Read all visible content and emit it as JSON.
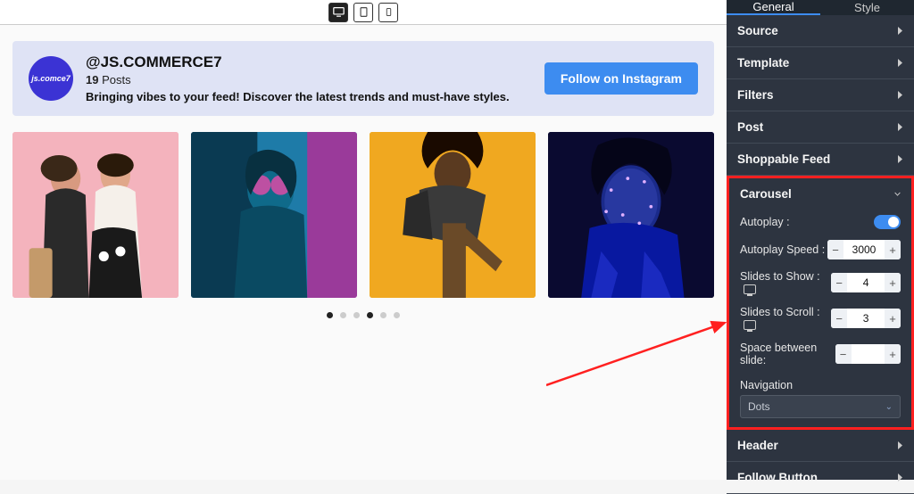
{
  "deviceBar": {
    "desktop": "desktop",
    "tablet": "tablet",
    "mobile": "mobile"
  },
  "profile": {
    "avatarText": "js.comce7",
    "handle": "@JS.COMMERCE7",
    "postsCount": "19",
    "postsSuffix": "Posts",
    "bio": "Bringing vibes to your feed! Discover the latest trends and must-have styles.",
    "followLabel": "Follow on Instagram"
  },
  "carouselDots": {
    "total": 6,
    "active": [
      0,
      3
    ]
  },
  "sidebar": {
    "tabs": {
      "general": "General",
      "style": "Style"
    },
    "rows": {
      "source": "Source",
      "template": "Template",
      "filters": "Filters",
      "post": "Post",
      "shoppable": "Shoppable Feed",
      "carousel": "Carousel",
      "header": "Header",
      "followButton": "Follow Button"
    },
    "carouselCtrl": {
      "autoplay": "Autoplay :",
      "autoplaySpeed": "Autoplay Speed :",
      "autoplaySpeedVal": "3000",
      "slidesShow": "Slides to Show :",
      "slidesShowVal": "4",
      "slidesScroll": "Slides to Scroll :",
      "slidesScrollVal": "3",
      "spaceBetween": "Space between slide:",
      "spaceBetweenVal": "",
      "navigation": "Navigation",
      "navigationVal": "Dots"
    }
  }
}
